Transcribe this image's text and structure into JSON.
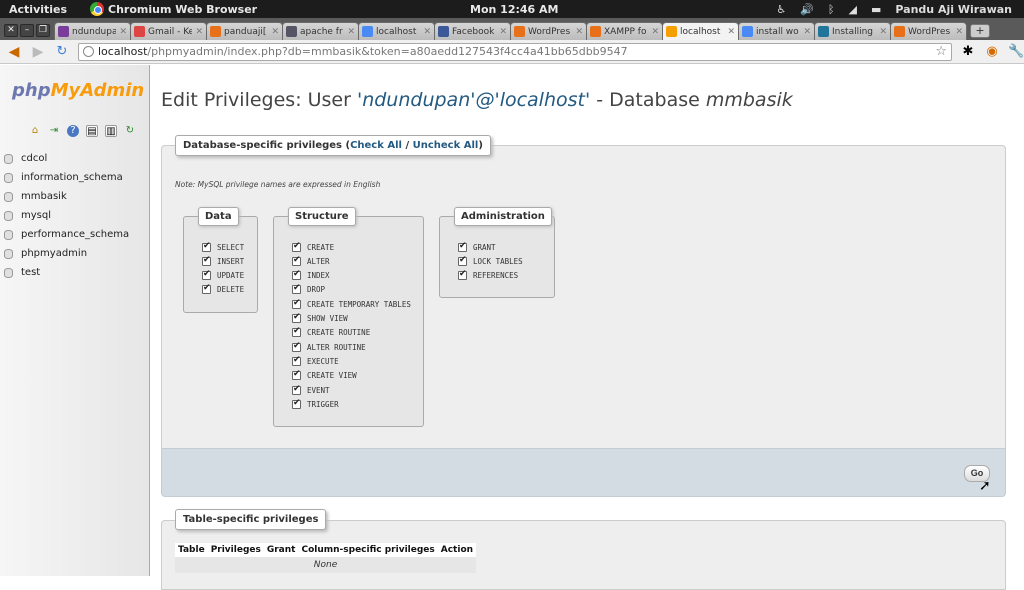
{
  "system_panel": {
    "activities": "Activities",
    "app_title": "Chromium Web Browser",
    "clock": "Mon 12:46 AM",
    "user_name": "Pandu Aji Wirawan"
  },
  "browser": {
    "tabs": [
      {
        "title": "ndundupan",
        "favicon_color": "#7a3d9a"
      },
      {
        "title": "Gmail - Ke",
        "favicon_color": "#d44"
      },
      {
        "title": "panduaji[",
        "favicon_color": "#e8701a"
      },
      {
        "title": "apache fr",
        "favicon_color": "#556"
      },
      {
        "title": "localhost",
        "favicon_color": "#4a8af4"
      },
      {
        "title": "Facebook",
        "favicon_color": "#3b5998"
      },
      {
        "title": "WordPres",
        "favicon_color": "#e8701a"
      },
      {
        "title": "XAMPP fo",
        "favicon_color": "#e8701a"
      },
      {
        "title": "localhost",
        "favicon_color": "#f6a000",
        "active": true
      },
      {
        "title": "install wo",
        "favicon_color": "#4a8af4"
      },
      {
        "title": "Installing",
        "favicon_color": "#21759b"
      },
      {
        "title": "WordPres",
        "favicon_color": "#e8701a"
      }
    ],
    "url_host": "localhost",
    "url_rest": "/phpmyadmin/index.php?db=mmbasik&token=a80aedd127543f4cc4a41bb65dbb9547"
  },
  "sidebar": {
    "logo_php": "php",
    "logo_myadmin": "MyAdmin",
    "databases": [
      "cdcol",
      "information_schema",
      "mmbasik",
      "mysql",
      "performance_schema",
      "phpmyadmin",
      "test"
    ]
  },
  "main": {
    "title_prefix": "Edit Privileges: User ",
    "title_user": "'ndundupan'@'localhost'",
    "title_mid": " - Database ",
    "title_db": "mmbasik",
    "db_priv_legend": "Database-specific privileges (",
    "check_all": "Check All",
    "sep": " / ",
    "uncheck_all": "Uncheck All",
    "legend_close": ")",
    "note": "Note: MySQL privilege names are expressed in English",
    "groups": {
      "data": {
        "label": "Data",
        "privs": [
          "SELECT",
          "INSERT",
          "UPDATE",
          "DELETE"
        ]
      },
      "structure": {
        "label": "Structure",
        "privs": [
          "CREATE",
          "ALTER",
          "INDEX",
          "DROP",
          "CREATE TEMPORARY TABLES",
          "SHOW VIEW",
          "CREATE ROUTINE",
          "ALTER ROUTINE",
          "EXECUTE",
          "CREATE VIEW",
          "EVENT",
          "TRIGGER"
        ]
      },
      "administration": {
        "label": "Administration",
        "privs": [
          "GRANT",
          "LOCK TABLES",
          "REFERENCES"
        ]
      }
    },
    "go_label": "Go",
    "table_priv_legend": "Table-specific privileges",
    "table_headers": [
      "Table",
      "Privileges",
      "Grant",
      "Column-specific privileges",
      "Action"
    ],
    "table_empty": "None"
  }
}
